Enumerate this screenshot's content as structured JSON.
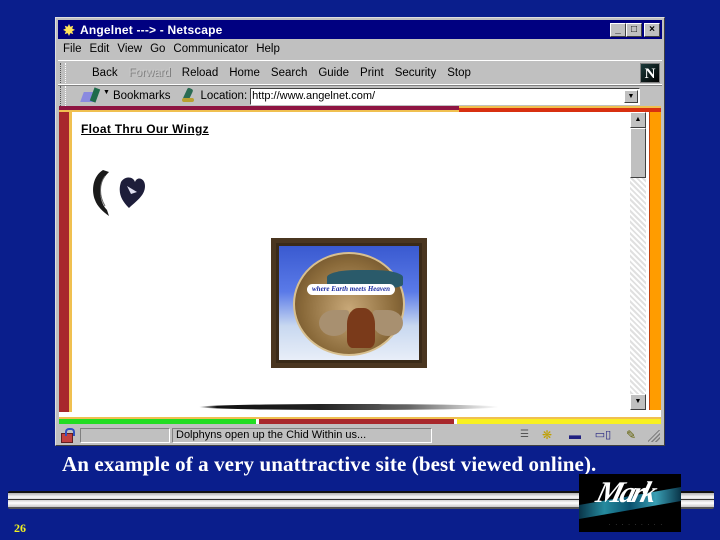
{
  "browser": {
    "title": "Angelnet ---> - Netscape",
    "window_buttons": {
      "minimize": "_",
      "maximize": "□",
      "close": "×"
    },
    "menu": [
      "File",
      "Edit",
      "View",
      "Go",
      "Communicator",
      "Help"
    ],
    "toolbar": [
      {
        "label": "Back",
        "enabled": true
      },
      {
        "label": "Forward",
        "enabled": false
      },
      {
        "label": "Reload",
        "enabled": true
      },
      {
        "label": "Home",
        "enabled": true
      },
      {
        "label": "Search",
        "enabled": true
      },
      {
        "label": "Guide",
        "enabled": true
      },
      {
        "label": "Print",
        "enabled": true
      },
      {
        "label": "Security",
        "enabled": true
      },
      {
        "label": "Stop",
        "enabled": true
      }
    ],
    "brand_logo": "N",
    "bookmarks_label": "Bookmarks",
    "location_label": "Location:",
    "location_value": "http://www.angelnet.com/",
    "status_text": "Dolphyns open up the Chid Within us...",
    "status_icons": [
      "component-bar-icon",
      "navigator-icon",
      "mail-icon",
      "discussion-icon",
      "composer-icon"
    ]
  },
  "page": {
    "title": "Float Thru Our Wingz",
    "banner_text": "where Earth meets Heaven",
    "frame_colors": {
      "top_left": "#8e1542",
      "top_right": "#d83010",
      "left": "#a8282c",
      "right": "#ff9c00",
      "bottom_green": "#22dd22",
      "bottom_red": "#a8282c",
      "bottom_yellow": "#f8f020",
      "inner_line": "#f0c050"
    }
  },
  "slide": {
    "caption": "An example of a very unattractive site (best viewed online).",
    "number": "26",
    "logo_text": "Mark",
    "background": "#0a1e8c"
  }
}
